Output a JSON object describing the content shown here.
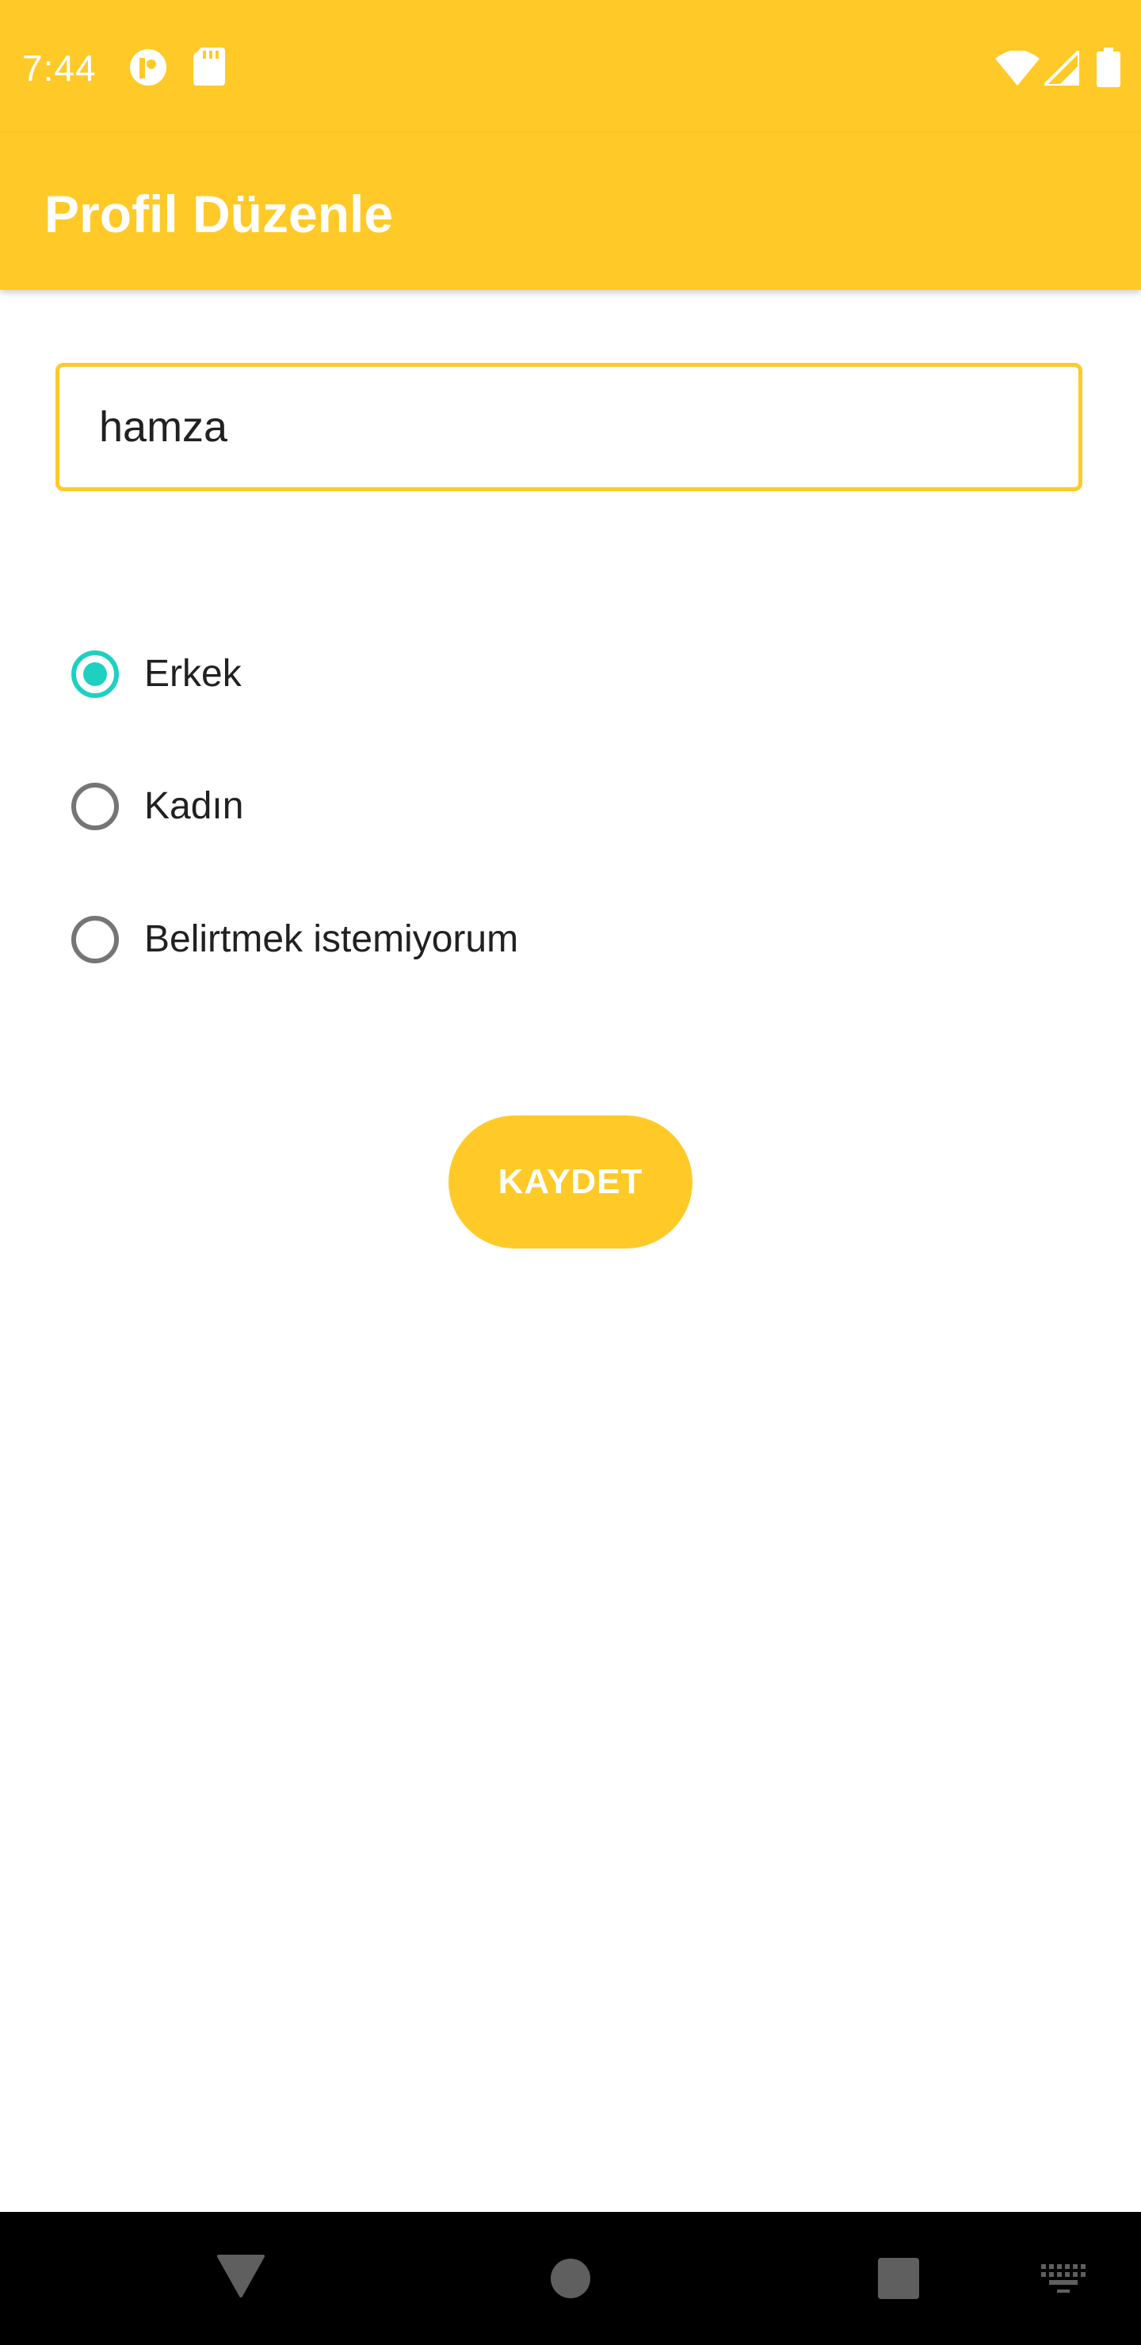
{
  "status_bar": {
    "time": "7:44",
    "icons": [
      "notification-app-icon",
      "sd-card-icon",
      "wifi-icon",
      "cell-signal-icon",
      "battery-icon"
    ]
  },
  "app_bar": {
    "title": "Profil Düzenle"
  },
  "form": {
    "name_value": "hamza",
    "gender_options": [
      {
        "label": "Erkek",
        "checked": true
      },
      {
        "label": "Kadın",
        "checked": false
      },
      {
        "label": "Belirtmek istemiyorum",
        "checked": false
      }
    ],
    "save_label": "KAYDET"
  },
  "nav_bar": {
    "icons": [
      "back-icon",
      "home-icon",
      "recents-icon",
      "keyboard-icon"
    ]
  },
  "colors": {
    "accent": "#FFCA28",
    "radio_checked": "#1DD1C1",
    "radio_unchecked": "#757575",
    "nav_background": "#000000"
  }
}
